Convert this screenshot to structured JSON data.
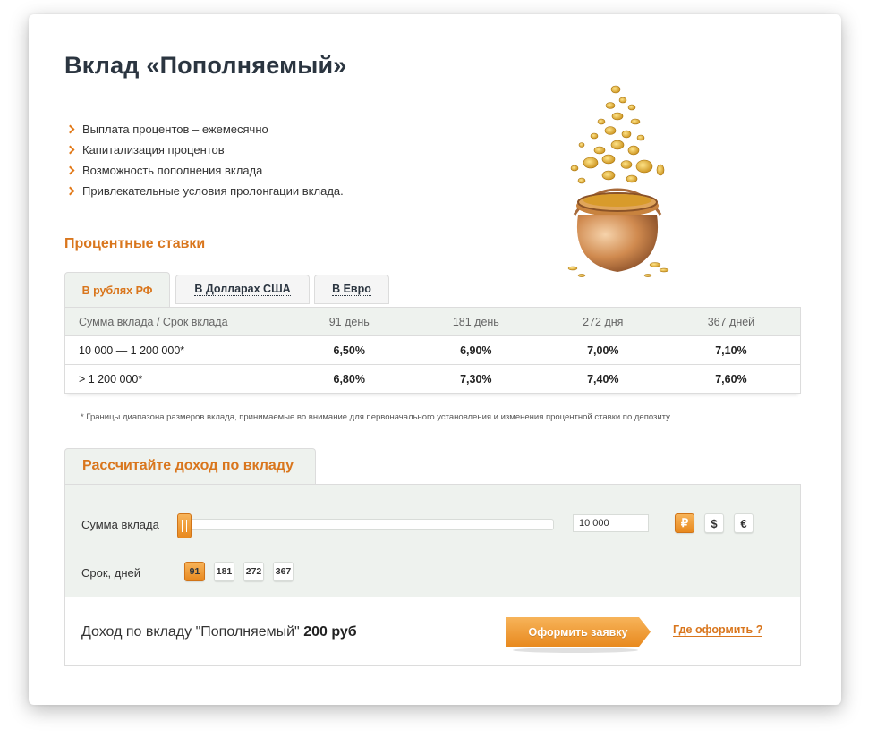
{
  "title": "Вклад «Пополняемый»",
  "features": [
    "Выплата процентов – ежемесячно",
    "Капитализация процентов",
    "Возможность пополнения вклада",
    "Привлекательные условия пролонгации вклада."
  ],
  "rates": {
    "title": "Процентные ставки",
    "tabs": [
      "В рублях РФ",
      "В Долларах США",
      "В Евро"
    ],
    "active_tab": "В рублях РФ",
    "header": [
      "Сумма вклада / Срок вклада",
      "91 день",
      "181 день",
      "272 дня",
      "367 дней"
    ],
    "rows": [
      [
        "10 000 — 1 200 000*",
        "6,50%",
        "6,90%",
        "7,00%",
        "7,10%"
      ],
      [
        "> 1 200 000*",
        "6,80%",
        "7,30%",
        "7,40%",
        "7,60%"
      ]
    ],
    "footnote": "* Границы диапазона размеров вклада, принимаемые во внимание для первоначального установления и изменения процентной ставки по депозиту."
  },
  "calculator": {
    "title": "Рассчитайте доход по вкладу",
    "amount_label": "Сумма вклада",
    "amount_value": "10 000",
    "slider_fraction": 0,
    "currencies": [
      "₽",
      "$",
      "€"
    ],
    "active_currency": "₽",
    "term_label": "Срок, дней",
    "terms": [
      "91",
      "181",
      "272",
      "367"
    ],
    "active_term": "91",
    "income_text": "Доход по вкладу \"Пополняемый\"",
    "income_value": "200 руб",
    "apply_label": "Оформить заявку",
    "where_label": "Где оформить ?"
  },
  "colors": {
    "accent": "#d9761d",
    "button": "#e8891e",
    "panel": "#eef2ee",
    "title": "#2b3540"
  },
  "icons": {
    "bullet": "chevron-right-icon",
    "illustration": "coin-pot-illustration"
  }
}
